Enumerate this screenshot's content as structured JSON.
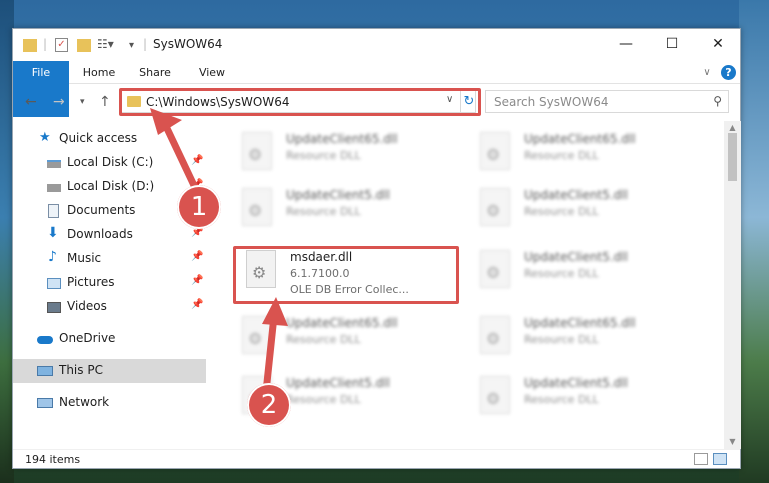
{
  "window": {
    "title": "SysWOW64"
  },
  "window_controls": {
    "minimize": "—",
    "maximize": "☐",
    "close": "✕"
  },
  "ribbon": {
    "tabs": [
      "File",
      "Home",
      "Share",
      "View"
    ],
    "help": "?",
    "expand": "∨"
  },
  "address": {
    "path": "C:\\Windows\\SysWOW64",
    "search_placeholder": "Search SysWOW64"
  },
  "nav_pane": {
    "quick_access": "Quick access",
    "items": [
      {
        "label": "Local Disk (C:)"
      },
      {
        "label": "Local Disk (D:)"
      },
      {
        "label": "Documents"
      },
      {
        "label": "Downloads"
      },
      {
        "label": "Music"
      },
      {
        "label": "Pictures"
      },
      {
        "label": "Videos"
      }
    ],
    "onedrive": "OneDrive",
    "this_pc": "This PC",
    "network": "Network"
  },
  "files": [
    {
      "name": "UpdateClient65.dll",
      "type": "Resource DLL"
    },
    {
      "name": "UpdateClient65.dll",
      "type": "Resource DLL"
    },
    {
      "name": "UpdateClient5.dll",
      "type": "Resource DLL"
    },
    {
      "name": "UpdateClient5.dll",
      "type": "Resource DLL"
    },
    {
      "name": "msdaer.dll",
      "version": "6.1.7100.0",
      "description": "OLE DB Error Collec..."
    },
    {
      "name": "UpdateClient5.dll",
      "type": "Resource DLL"
    },
    {
      "name": "UpdateClient65.dll",
      "type": "Resource DLL"
    },
    {
      "name": "UpdateClient65.dll",
      "type": "Resource DLL"
    },
    {
      "name": "UpdateClient5.dll",
      "type": "Resource DLL"
    },
    {
      "name": "UpdateClient5.dll",
      "type": "Resource DLL"
    }
  ],
  "status": {
    "count": "194 items"
  },
  "annotations": {
    "step1": "1",
    "step2": "2",
    "highlight_color": "#d9534f"
  },
  "icons": [
    "folder-icon",
    "checklist-icon",
    "properties-icon",
    "back-icon",
    "forward-icon",
    "up-icon",
    "refresh-icon",
    "search-icon",
    "pin-icon",
    "gear-file-icon"
  ]
}
